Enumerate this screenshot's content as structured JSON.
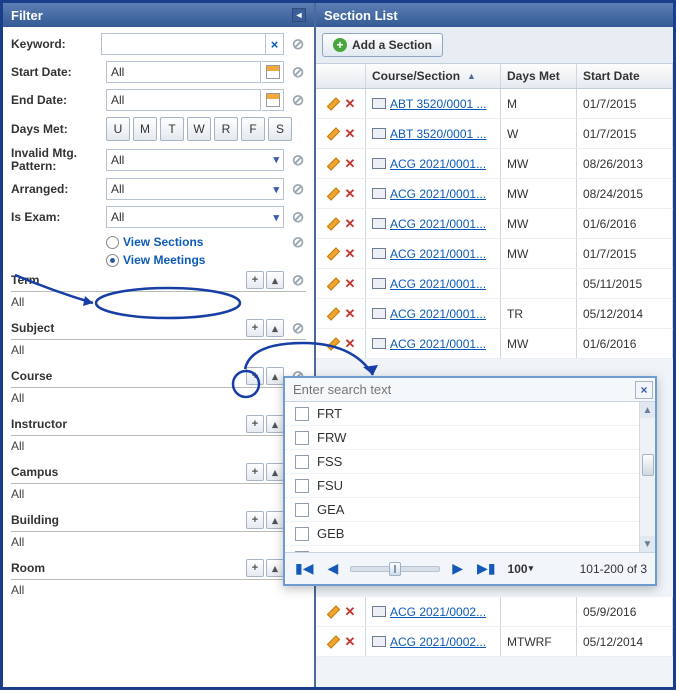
{
  "filter": {
    "title": "Filter",
    "keyword": {
      "label": "Keyword:",
      "value": ""
    },
    "start_date": {
      "label": "Start Date:",
      "value": "All"
    },
    "end_date": {
      "label": "End Date:",
      "value": "All"
    },
    "days_met": {
      "label": "Days Met:",
      "buttons": [
        "U",
        "M",
        "T",
        "W",
        "R",
        "F",
        "S"
      ]
    },
    "invalid_mtg": {
      "label": "Invalid Mtg. Pattern:",
      "value": "All"
    },
    "arranged": {
      "label": "Arranged:",
      "value": "All"
    },
    "is_exam": {
      "label": "Is Exam:",
      "value": "All"
    },
    "view_sections": "View Sections",
    "view_meetings": "View Meetings",
    "categories": [
      {
        "name": "Term",
        "value": "All"
      },
      {
        "name": "Subject",
        "value": "All"
      },
      {
        "name": "Course",
        "value": "All"
      },
      {
        "name": "Instructor",
        "value": "All"
      },
      {
        "name": "Campus",
        "value": "All"
      },
      {
        "name": "Building",
        "value": "All"
      },
      {
        "name": "Room",
        "value": "All"
      }
    ]
  },
  "section_list": {
    "title": "Section List",
    "add_label": "Add a Section",
    "columns": {
      "course": "Course/Section",
      "days": "Days Met",
      "start": "Start Date"
    },
    "rows": [
      {
        "link": "ABT 3520/0001 ...",
        "days": "M",
        "start": "01/7/2015"
      },
      {
        "link": "ABT 3520/0001 ...",
        "days": "W",
        "start": "01/7/2015"
      },
      {
        "link": "ACG 2021/0001...",
        "days": "MW",
        "start": "08/26/2013"
      },
      {
        "link": "ACG 2021/0001...",
        "days": "MW",
        "start": "08/24/2015"
      },
      {
        "link": "ACG 2021/0001...",
        "days": "MW",
        "start": "01/6/2016"
      },
      {
        "link": "ACG 2021/0001...",
        "days": "MW",
        "start": "01/7/2015"
      },
      {
        "link": "ACG 2021/0001...",
        "days": "",
        "start": "05/11/2015"
      },
      {
        "link": "ACG 2021/0001...",
        "days": "TR",
        "start": "05/12/2014"
      },
      {
        "link": "ACG 2021/0001...",
        "days": "MW",
        "start": "01/6/2016"
      }
    ],
    "rows_after_popup": [
      {
        "link": "ACG 2021/0002...",
        "days": "",
        "start": "05/9/2016"
      },
      {
        "link": "ACG 2021/0002...",
        "days": "MTWRF",
        "start": "05/12/2014"
      }
    ]
  },
  "popup": {
    "placeholder": "Enter search text",
    "items": [
      "FRT",
      "FRW",
      "FSS",
      "FSU",
      "GEA",
      "GEB",
      "GEO"
    ],
    "page_size": "100",
    "range": "101-200 of 3"
  }
}
